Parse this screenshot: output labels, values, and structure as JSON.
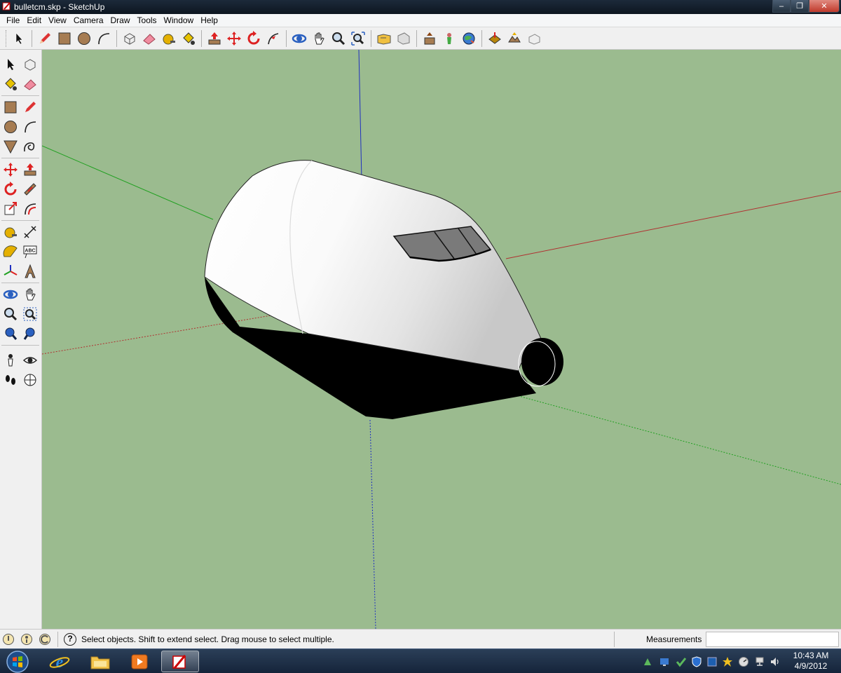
{
  "window": {
    "title": "bulletcm.skp - SketchUp",
    "minimize_glyph": "–",
    "maximize_glyph": "❐",
    "close_glyph": "✕"
  },
  "menu": {
    "items": [
      "File",
      "Edit",
      "View",
      "Camera",
      "Draw",
      "Tools",
      "Window",
      "Help"
    ]
  },
  "toolbar": {
    "icons": [
      "select-icon",
      "pencil-icon",
      "rectangle-icon",
      "circle-icon",
      "arc-icon",
      "make-component-icon",
      "eraser-icon",
      "tape-measure-icon",
      "paint-bucket-icon",
      "push-pull-icon",
      "move-icon",
      "rotate-icon",
      "follow-me-icon",
      "orbit-icon",
      "pan-icon",
      "zoom-icon",
      "zoom-extents-icon",
      "get-models-icon",
      "share-model-icon",
      "share-component-icon",
      "position-camera-icon",
      "google-earth-icon",
      "add-location-icon",
      "toggle-terrain-icon",
      "preview-icon"
    ]
  },
  "left_toolbar": {
    "icons": [
      "select-icon",
      "make-component-icon",
      "paint-bucket-icon",
      "eraser-icon",
      "rectangle-icon",
      "pencil-icon",
      "circle-icon",
      "arc-icon",
      "polygon-icon",
      "freehand-icon",
      "move-icon",
      "push-pull-icon",
      "rotate-icon",
      "follow-me-icon",
      "scale-icon",
      "offset-icon",
      "tape-measure-icon",
      "dimension-icon",
      "protractor-icon",
      "text-icon",
      "axes-icon",
      "3d-text-icon",
      "orbit-icon",
      "pan-icon",
      "zoom-icon",
      "zoom-window-icon",
      "previous-view-icon",
      "zoom-extents-icon",
      "position-camera-icon",
      "look-around-icon",
      "walk-icon",
      "section-plane-icon"
    ],
    "text_tool_label": "ABC"
  },
  "status": {
    "hint": "Select objects. Shift to extend select. Drag mouse to select multiple.",
    "measurements_label": "Measurements",
    "measurements_value": "",
    "help_glyph": "?"
  },
  "taskbar": {
    "time": "10:43 AM",
    "date": "4/9/2012"
  },
  "colors": {
    "viewport_background": "#9bbb8f",
    "red_axis": "#b03030",
    "green_axis": "#20a020",
    "blue_axis": "#2030c0"
  }
}
